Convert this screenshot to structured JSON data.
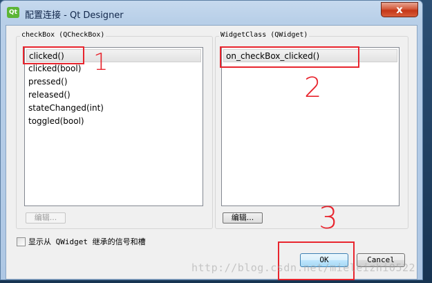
{
  "window": {
    "app_icon": "Qt",
    "title": "配置连接 - Qt Designer",
    "close_glyph": "x"
  },
  "left_panel": {
    "label": "checkBox (QCheckBox)",
    "items": [
      "clicked()",
      "clicked(bool)",
      "pressed()",
      "released()",
      "stateChanged(int)",
      "toggled(bool)"
    ],
    "selected_index": 0,
    "edit_label": "编辑..."
  },
  "right_panel": {
    "label": "WidgetClass (QWidget)",
    "items": [
      "on_checkBox_clicked()"
    ],
    "selected_index": 0,
    "edit_label": "编辑..."
  },
  "show_inherited": {
    "label": "显示从 QWidget 继承的信号和槽",
    "checked": false
  },
  "buttons": {
    "ok": "OK",
    "cancel": "Cancel"
  },
  "annotations": {
    "one": "1",
    "two": "2",
    "three": "3",
    "color": "#e8242d"
  },
  "watermark": "http://blog.csdn.net/mieleizhi0522"
}
